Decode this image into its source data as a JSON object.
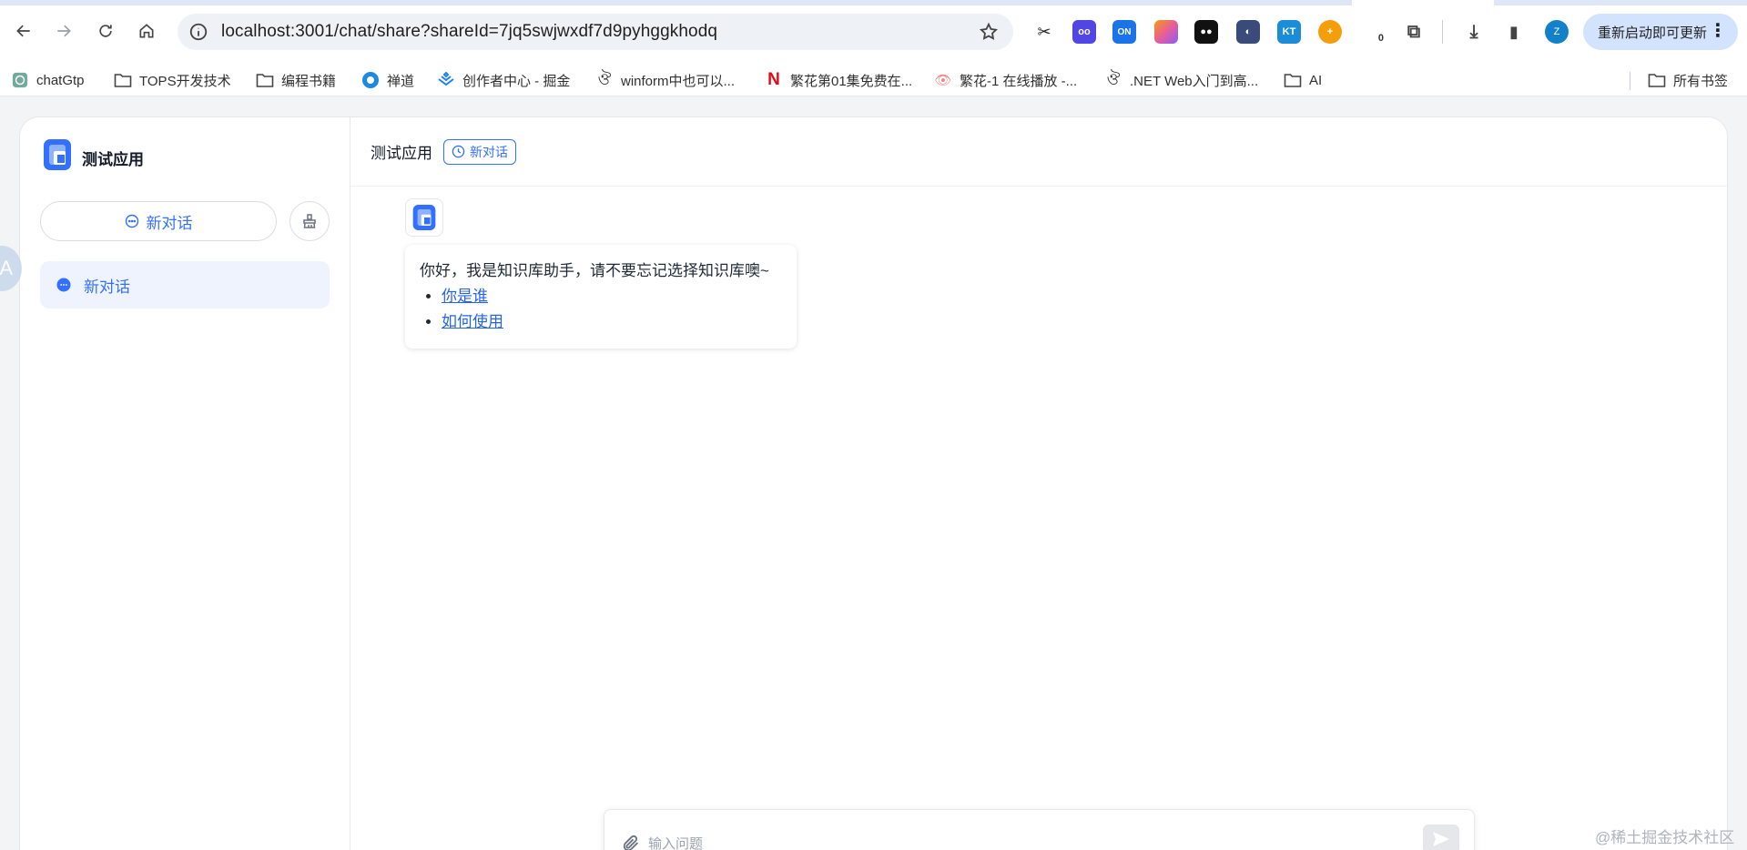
{
  "browser": {
    "url": "localhost:3001/chat/share?shareId=7jq5swjwxdf7d9pyhggkhodq",
    "update_label": "重新启动即可更新",
    "profile_initial": "Z",
    "extensions": [
      {
        "name": "scissors-extension",
        "text": "",
        "color": "#ffffff"
      },
      {
        "name": "bot-extension",
        "text": "oo",
        "color": "#4f46e5"
      },
      {
        "name": "on-extension",
        "text": "ON",
        "color": "#1a73e8"
      },
      {
        "name": "color-picker-extension",
        "text": "",
        "color": "#e85d9a"
      },
      {
        "name": "glasses-extension",
        "text": "",
        "color": "#111111"
      },
      {
        "name": "vpn-extension",
        "text": "",
        "color": "#3a4b7a"
      },
      {
        "name": "kt-extension",
        "text": "KT",
        "color": "#1a8cd8"
      },
      {
        "name": "orange-extension",
        "text": "",
        "color": "#f59e0b"
      },
      {
        "name": "counter-extension",
        "text": "0",
        "color": "#ffffff"
      }
    ]
  },
  "bookmarks": [
    {
      "label": "chatGtp",
      "icon": "chatgpt-icon"
    },
    {
      "label": "TOPS开发技术",
      "icon": "folder-icon"
    },
    {
      "label": "编程书籍",
      "icon": "folder-icon"
    },
    {
      "label": "禅道",
      "icon": "zentao-icon"
    },
    {
      "label": "创作者中心 - 掘金",
      "icon": "juejin-icon"
    },
    {
      "label": "winform中也可以...",
      "icon": "cnblogs-icon"
    },
    {
      "label": "繁花第01集免费在...",
      "icon": "netflix-icon"
    },
    {
      "label": "繁花-1 在线播放 -...",
      "icon": "eye-icon"
    },
    {
      "label": ".NET Web入门到高...",
      "icon": "cnblogs-icon"
    },
    {
      "label": "AI",
      "icon": "folder-icon"
    }
  ],
  "all_bookmarks_label": "所有书签",
  "sidebar": {
    "app_title": "测试应用",
    "new_chat_label": "新对话",
    "history": [
      {
        "label": "新对话"
      }
    ]
  },
  "header": {
    "title": "测试应用",
    "tag_label": "新对话"
  },
  "chat": {
    "greeting": "你好，我是知识库助手，请不要忘记选择知识库噢~",
    "suggestions": [
      "你是谁",
      "如何使用"
    ]
  },
  "input": {
    "placeholder": "输入问题"
  },
  "watermark": "@稀土掘金技术社区",
  "colors": {
    "accent": "#3370ff",
    "update_button_bg": "#d3e3fd"
  }
}
